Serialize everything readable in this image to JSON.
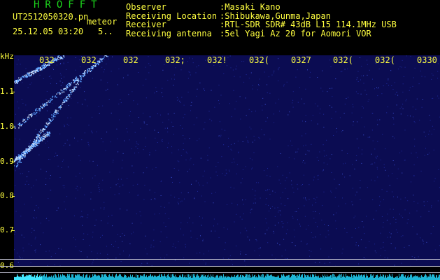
{
  "header": {
    "logo": "HROFFT",
    "file_name": "UT2512050320.pn",
    "meteor_label": "meteor",
    "datetime": "25.12.05 03:20",
    "meteor_count": "5.."
  },
  "info": {
    "labels": [
      "Observer",
      "Receiving Location",
      "Receiver",
      "Receiving antenna"
    ],
    "values": [
      ":Masaki Kano",
      ":Shibukawa,Gunma,Japan",
      ":RTL-SDR SDR# 43dB L15 114.1MHz USB",
      ":5el Yagi Az 20 for Aomori VOR"
    ]
  },
  "spectrogram": {
    "unit_label": "kHz",
    "y_ticks": [
      "1.1",
      "1.0",
      "0.9",
      "0.8",
      "0.7",
      "0.6"
    ],
    "time_labels": [
      "032",
      "032",
      "032",
      "032;",
      "032!",
      "032(",
      "0327",
      "032(",
      "032(",
      "0330"
    ],
    "background_color": "#0b0c52",
    "trace_color": "#5aa0ff"
  }
}
